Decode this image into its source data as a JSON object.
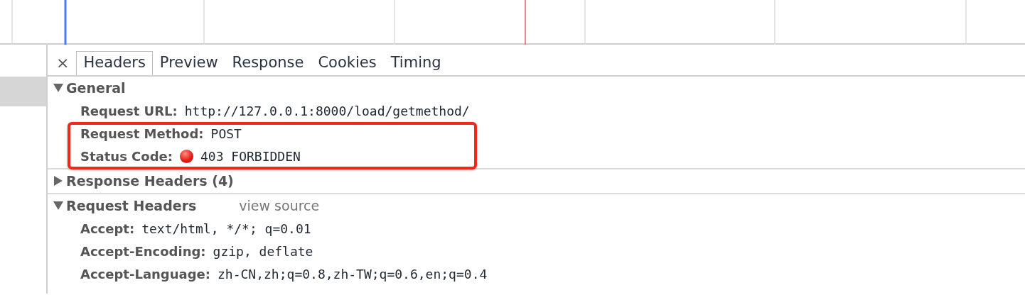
{
  "tabs_close": "×",
  "tabs": [
    {
      "label": "Headers",
      "selected": true
    },
    {
      "label": "Preview",
      "selected": false
    },
    {
      "label": "Response",
      "selected": false
    },
    {
      "label": "Cookies",
      "selected": false
    },
    {
      "label": "Timing",
      "selected": false
    }
  ],
  "sections": [
    {
      "title": "General",
      "expanded": true,
      "rows": [
        {
          "name": "Request URL:",
          "value": "http://127.0.0.1:8000/load/getmethod/"
        },
        {
          "name": "Request Method:",
          "value": "POST"
        },
        {
          "name": "Status Code:",
          "value": "403 FORBIDDEN",
          "color": "#e3150e"
        }
      ]
    },
    {
      "title": "Response Headers (4)",
      "expanded": false
    },
    {
      "title": "Request Headers",
      "expanded": true,
      "link": "view source",
      "rows": [
        {
          "name": "Accept:",
          "value": "text/html, */*; q=0.01"
        },
        {
          "name": "Accept-Encoding:",
          "value": "gzip, deflate"
        },
        {
          "name": "Accept-Language:",
          "value": "zh-CN,zh;q=0.8,zh-TW;q=0.6,en;q=0.4"
        }
      ]
    }
  ]
}
